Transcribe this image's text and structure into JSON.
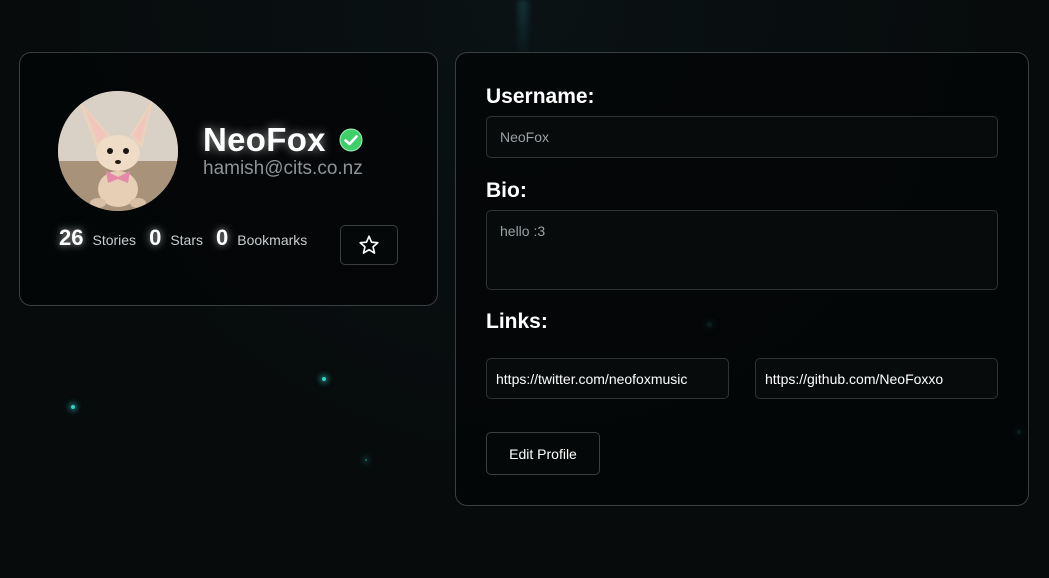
{
  "profile": {
    "display_name": "NeoFox",
    "email": "hamish@cits.co.nz",
    "verified_icon": "verified-check-icon",
    "avatar_alt": "fennec-fox-avatar",
    "stats": [
      {
        "value": "26",
        "label": "Stories"
      },
      {
        "value": "0",
        "label": "Stars"
      },
      {
        "value": "0",
        "label": "Bookmarks"
      }
    ],
    "star_icon": "star-icon"
  },
  "edit_form": {
    "username_label": "Username:",
    "username_value": "NeoFox",
    "bio_label": "Bio:",
    "bio_value": "hello :3",
    "links_label": "Links:",
    "links": [
      "https://twitter.com/neofoxmusic",
      "https://github.com/NeoFoxxo"
    ],
    "edit_button_label": "Edit Profile"
  },
  "colors": {
    "background": "#070b0c",
    "card_border": "#3a3f42",
    "verified_green": "#3ecf6a",
    "particle": "#2fd3c6"
  }
}
